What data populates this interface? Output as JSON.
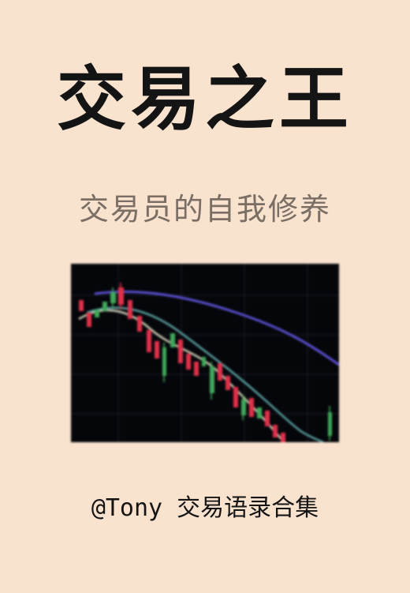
{
  "cover": {
    "title": "交易之王",
    "subtitle": "交易员的自我修养",
    "author_line": "@Tony 交易语录合集"
  },
  "image": {
    "description_icon": "candlestick-chart-photo",
    "colors": {
      "background": "#05060a",
      "bear": "#e0304a",
      "bull": "#3fa85a",
      "ma_short": "#c9c7b0",
      "ma_mid": "#5aa0a0",
      "ma_long": "#5a4fd0"
    }
  }
}
